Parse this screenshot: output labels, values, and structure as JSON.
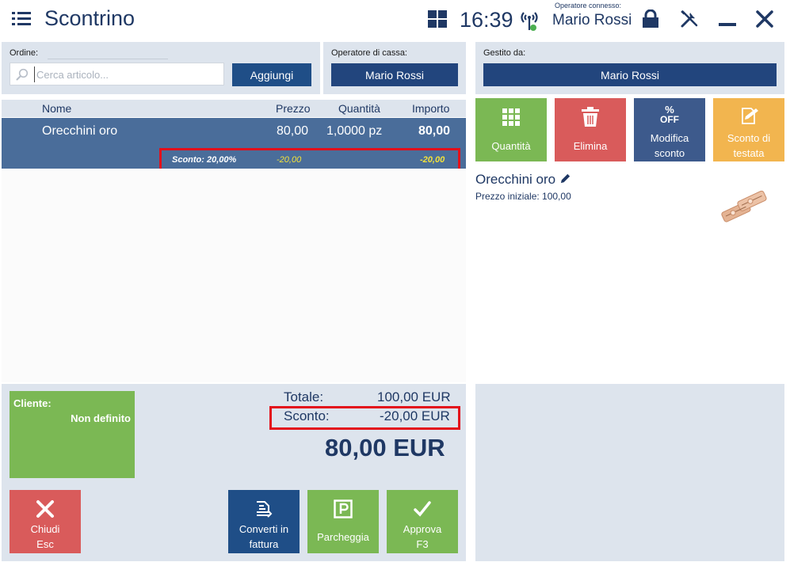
{
  "header": {
    "title": "Scontrino",
    "time": "16:39",
    "operator_label": "Operatore connesso:",
    "operator_name": "Mario Rossi"
  },
  "order_panel": {
    "order_label": "Ordine:",
    "search_placeholder": "Cerca articolo...",
    "add_button": "Aggiungi"
  },
  "cashier_panel": {
    "label": "Operatore di cassa:",
    "value": "Mario Rossi"
  },
  "managed_panel": {
    "label": "Gestito da:",
    "value": "Mario Rossi"
  },
  "table": {
    "columns": [
      "Nome",
      "Prezzo",
      "Quantità",
      "Importo"
    ],
    "rows": [
      {
        "name": "Orecchini oro",
        "price": "80,00",
        "quantity": "1,0000 pz",
        "amount": "80,00",
        "discount_label": "Sconto: 20,00%",
        "discount_price": "-20,00",
        "discount_amount": "-20,00"
      }
    ]
  },
  "tiles": [
    {
      "label": "Quantità",
      "icon": "grid-icon",
      "color": "#7bb854"
    },
    {
      "label": "Elimina",
      "icon": "trash-icon",
      "color": "#d95b5b"
    },
    {
      "label": "Modifica sconto",
      "icon": "percent-off-icon",
      "color": "#3d5a8c",
      "icon_text_top": "%",
      "icon_text_bottom": "OFF"
    },
    {
      "label": "Sconto di testata",
      "icon": "document-edit-icon",
      "color": "#f2b54f"
    }
  ],
  "item_details": {
    "name": "Orecchini oro",
    "price_label": "Prezzo iniziale: 100,00"
  },
  "customer": {
    "label": "Cliente:",
    "value": "Non definito"
  },
  "totals": {
    "total_label": "Totale:",
    "total_value": "100,00 EUR",
    "discount_label": "Sconto:",
    "discount_value": "-20,00 EUR",
    "grand_total": "80,00 EUR"
  },
  "actions": {
    "close_line1": "Chiudi",
    "close_line2": "Esc",
    "invoice_line1": "Converti in",
    "invoice_line2": "fattura",
    "park": "Parcheggia",
    "approve_line1": "Approva",
    "approve_line2": "F3"
  },
  "colors": {
    "navy": "#1f3864",
    "panel": "#dde4ed",
    "selected_row": "#4a6d9a",
    "highlight": "#e3101b"
  }
}
